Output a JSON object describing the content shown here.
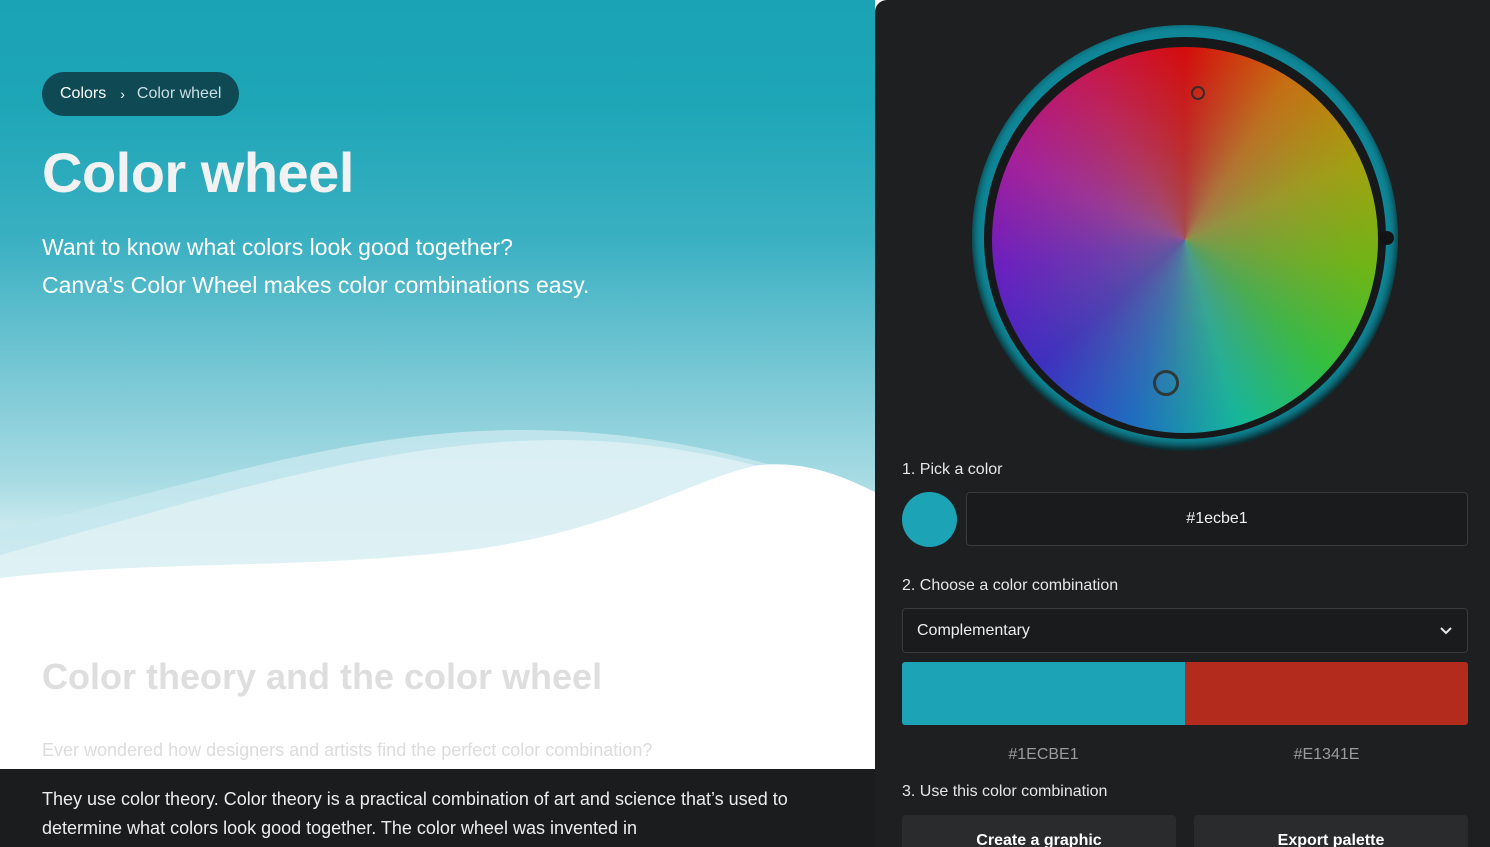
{
  "breadcrumb": {
    "parent": "Colors",
    "current": "Color wheel"
  },
  "hero": {
    "title": "Color wheel",
    "subtitle_line1": "Want to know what colors look good together?",
    "subtitle_line2": "Canva's Color Wheel makes color combinations easy."
  },
  "article": {
    "heading": "Color theory and the color wheel",
    "intro": "Ever wondered how designers and artists find the perfect color combination?",
    "body": "They use color theory. Color theory is a practical combination of art and science that’s used to determine what colors look good together. The color wheel was invented in"
  },
  "tool": {
    "step1_label": "1. Pick a color",
    "hex_value": "#1ecbe1",
    "step2_label": "2. Choose a color combination",
    "combination": "Complementary",
    "palette": [
      {
        "hex": "#1ECBE1",
        "display_color": "#1ca3b6"
      },
      {
        "hex": "#E1341E",
        "display_color": "#b22b1d"
      }
    ],
    "step3_label": "3. Use this color combination",
    "create_button": "Create a graphic",
    "export_button": "Export palette"
  },
  "colors": {
    "hero_teal": "#1aa3b5",
    "panel_bg": "#1e1f21",
    "breadcrumb_bg": "#0e4954"
  }
}
